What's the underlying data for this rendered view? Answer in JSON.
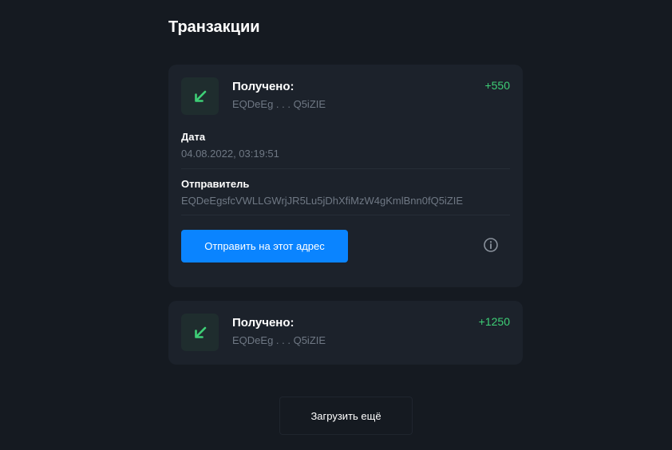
{
  "page": {
    "title": "Транзакции"
  },
  "transactions": [
    {
      "title": "Получено:",
      "address_short": "EQDeEg . . . Q5iZIE",
      "amount": "+550",
      "date_label": "Дата",
      "date": "04.08.2022, 03:19:51",
      "sender_label": "Отправитель",
      "sender": "EQDeEgsfcVWLLGWrjJR5Lu5jDhXfiMzW4gKmlBnn0fQ5iZIE",
      "send_button_label": "Отправить на этот адрес",
      "icon": "arrow-down-left-icon",
      "info_icon": "info-icon"
    },
    {
      "title": "Получено:",
      "address_short": "EQDeEg . . . Q5iZIE",
      "amount": "+1250",
      "icon": "arrow-down-left-icon"
    }
  ],
  "footer": {
    "load_more_label": "Загрузить ещё"
  },
  "colors": {
    "background": "#151a21",
    "card": "#1c222b",
    "accent": "#0a84ff",
    "positive": "#3ecf76",
    "muted_text": "#6f7884"
  }
}
